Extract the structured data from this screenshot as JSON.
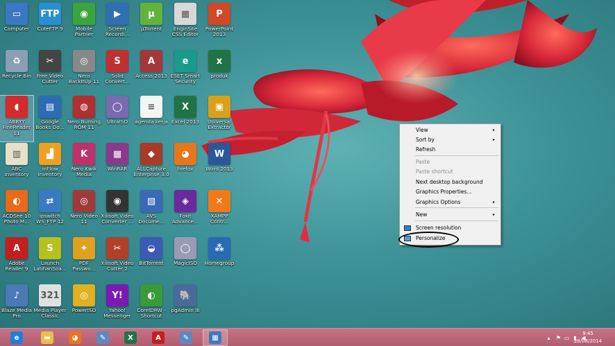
{
  "desktop": {
    "icons": [
      {
        "label": "Computer",
        "icon": "computer-icon",
        "color": "#3b78c4",
        "glyph": "▭"
      },
      {
        "label": "CuteFTP 9",
        "icon": "cuteftp-icon",
        "color": "#2a8fd0",
        "glyph": "FTP"
      },
      {
        "label": "Mobile\nPartner",
        "icon": "mobile-partner-icon",
        "color": "#3aa53a",
        "glyph": "◉"
      },
      {
        "label": "Screen\nRecordi...",
        "icon": "screen-recorder-icon",
        "color": "#2f6fb2",
        "glyph": "▶"
      },
      {
        "label": "µTorrent",
        "icon": "utorrent-icon",
        "color": "#62b33a",
        "glyph": "µ"
      },
      {
        "label": "EnginSite\nCSS Editor",
        "icon": "css-editor-icon",
        "color": "#d8d8d8",
        "glyph": "▦"
      },
      {
        "label": "PowerPoint\n2013",
        "icon": "powerpoint-icon",
        "color": "#d24726",
        "glyph": "P"
      },
      {
        "label": "Recycle Bin",
        "icon": "recycle-bin-icon",
        "color": "#8a9fb5",
        "glyph": "♻"
      },
      {
        "label": "Free Video\nCutter",
        "icon": "video-cutter-icon",
        "color": "#444444",
        "glyph": "✂"
      },
      {
        "label": "Nero\nBackItUp 11",
        "icon": "nero-backitup-icon",
        "color": "#888888",
        "glyph": "◎"
      },
      {
        "label": "Solid\nConvert...",
        "icon": "solid-converter-icon",
        "color": "#c03030",
        "glyph": "S"
      },
      {
        "label": "Access 2013",
        "icon": "access-icon",
        "color": "#a4373a",
        "glyph": "A"
      },
      {
        "label": "ESET Smart\nSecurity",
        "icon": "eset-icon",
        "color": "#1a9a8a",
        "glyph": "e"
      },
      {
        "label": "produk",
        "icon": "excel-file-icon",
        "color": "#217346",
        "glyph": "x"
      },
      {
        "label": "ABBYY\nFineReader\n11",
        "icon": "abbyy-icon",
        "color": "#d42a2a",
        "glyph": "◖"
      },
      {
        "label": "Google\nBooks Do...",
        "icon": "google-books-icon",
        "color": "#2d6bb5",
        "glyph": "▤"
      },
      {
        "label": "Nero Burning\nROM 11",
        "icon": "nero-burning-icon",
        "color": "#b03030",
        "glyph": "◍"
      },
      {
        "label": "UltraISO",
        "icon": "ultraiso-icon",
        "color": "#7a6ab0",
        "glyph": "◯"
      },
      {
        "label": "agenda kerja",
        "icon": "document-icon",
        "color": "#f4f4f4",
        "glyph": "≡"
      },
      {
        "label": "Excel 2013",
        "icon": "excel-icon",
        "color": "#217346",
        "glyph": "X"
      },
      {
        "label": "Universal\nExtractor",
        "icon": "universal-extractor-icon",
        "color": "#d9a11a",
        "glyph": "▣"
      },
      {
        "label": "ABC\nInventory",
        "icon": "abc-inventory-icon",
        "color": "#e8e0c8",
        "glyph": "▥"
      },
      {
        "label": "inFlow\nInventory",
        "icon": "inflow-icon",
        "color": "#f0a020",
        "glyph": "▟"
      },
      {
        "label": "Nero Kwik\nMedia",
        "icon": "nero-kwik-icon",
        "color": "#c0306a",
        "glyph": "K"
      },
      {
        "label": "WinRAR",
        "icon": "winrar-icon",
        "color": "#8a3a8a",
        "glyph": "▦"
      },
      {
        "label": "ALLCapture\nEnterprise 3.0",
        "icon": "allcapture-icon",
        "color": "#a83a2a",
        "glyph": "◆"
      },
      {
        "label": "firefox",
        "icon": "firefox-icon",
        "color": "#e8761a",
        "glyph": "◕"
      },
      {
        "label": "Word 2013",
        "icon": "word-icon",
        "color": "#2b579a",
        "glyph": "W"
      },
      {
        "label": "ACDSee 10\nPhoto M...",
        "icon": "acdsee-icon",
        "color": "#e86a1a",
        "glyph": "◐"
      },
      {
        "label": "ipswitch\nWS_FTP 12",
        "icon": "ws-ftp-icon",
        "color": "#3a7ac0",
        "glyph": "⇄"
      },
      {
        "label": "Nero Video\n11",
        "icon": "nero-video-icon",
        "color": "#a03a3a",
        "glyph": "◎"
      },
      {
        "label": "Xilisoft Video\nConverter ...",
        "icon": "xilisoft-converter-icon",
        "color": "#333333",
        "glyph": "◉"
      },
      {
        "label": "AVS\nDocume...",
        "icon": "avs-document-icon",
        "color": "#3a6ab5",
        "glyph": "▧"
      },
      {
        "label": "Foxit\nAdvance...",
        "icon": "foxit-icon",
        "color": "#6a2a9a",
        "glyph": "◈"
      },
      {
        "label": "XAMPP\nContr...",
        "icon": "xampp-icon",
        "color": "#f07a1a",
        "glyph": "✕"
      },
      {
        "label": "Adobe\nReader 9",
        "icon": "adobe-reader-icon",
        "color": "#c41e1e",
        "glyph": "A"
      },
      {
        "label": "Launch\nLatihanSoa...",
        "icon": "launch-icon",
        "color": "#b8c020",
        "glyph": "S"
      },
      {
        "label": "PDF\nPasswo...",
        "icon": "pdf-password-icon",
        "color": "#e0a020",
        "glyph": "✦"
      },
      {
        "label": "Xilisoft Video\nCutter 2",
        "icon": "xilisoft-cutter-icon",
        "color": "#b0402a",
        "glyph": "✂"
      },
      {
        "label": "BitTorrent",
        "icon": "bittorrent-icon",
        "color": "#3a5ab5",
        "glyph": "◒"
      },
      {
        "label": "MagicISO",
        "icon": "magiciso-icon",
        "color": "#9a9ab5",
        "glyph": "◯"
      },
      {
        "label": "Homegroup",
        "icon": "homegroup-icon",
        "color": "#2a6ab5",
        "glyph": "⁂"
      },
      {
        "label": "Blaze Media\nPro",
        "icon": "blaze-media-icon",
        "color": "#4a7ab5",
        "glyph": "♪"
      },
      {
        "label": "Media Player\nClassic",
        "icon": "media-player-classic-icon",
        "color": "#e0e0e0",
        "glyph": "321"
      },
      {
        "label": "PowerISO",
        "icon": "poweriso-icon",
        "color": "#e0b020",
        "glyph": "◎"
      },
      {
        "label": "Yahoo!\nMessenger",
        "icon": "yahoo-messenger-icon",
        "color": "#7a1ab0",
        "glyph": "Y!"
      },
      {
        "label": "CorelDRW -\nShortcut",
        "icon": "coreldraw-icon",
        "color": "#3a9a3a",
        "glyph": "◐"
      },
      {
        "label": "pgAdmin III",
        "icon": "pgadmin-icon",
        "color": "#4a6a9a",
        "glyph": "🐘"
      }
    ]
  },
  "context_menu": {
    "items": [
      {
        "label": "View",
        "disabled": false,
        "submenu": true,
        "name": "menu-item-view"
      },
      {
        "label": "Sort by",
        "disabled": false,
        "submenu": true,
        "name": "menu-item-sort-by"
      },
      {
        "label": "Refresh",
        "disabled": false,
        "submenu": false,
        "name": "menu-item-refresh"
      },
      {
        "label": "Paste",
        "disabled": true,
        "submenu": false,
        "name": "menu-item-paste"
      },
      {
        "label": "Paste shortcut",
        "disabled": true,
        "submenu": false,
        "name": "menu-item-paste-shortcut"
      },
      {
        "label": "Next desktop background",
        "disabled": false,
        "submenu": false,
        "name": "menu-item-next-background"
      },
      {
        "label": "Graphics Properties...",
        "disabled": false,
        "submenu": false,
        "name": "menu-item-graphics-properties"
      },
      {
        "label": "Graphics Options",
        "disabled": false,
        "submenu": true,
        "name": "menu-item-graphics-options"
      },
      {
        "label": "New",
        "disabled": false,
        "submenu": true,
        "name": "menu-item-new"
      },
      {
        "label": "Screen resolution",
        "disabled": false,
        "submenu": false,
        "name": "menu-item-screen-resolution"
      },
      {
        "label": "Personalize",
        "disabled": false,
        "submenu": false,
        "name": "menu-item-personalize"
      }
    ],
    "submenu_arrow": "▸"
  },
  "taskbar": {
    "buttons": [
      {
        "icon": "internet-explorer-icon",
        "glyph": "e",
        "color": "#1e7fd8"
      },
      {
        "icon": "file-explorer-icon",
        "glyph": "▬",
        "color": "#e8c04a"
      },
      {
        "icon": "firefox-icon",
        "glyph": "◕",
        "color": "#e8761a"
      },
      {
        "icon": "paint-icon",
        "glyph": "✎",
        "color": "#5a8ac0"
      },
      {
        "icon": "excel-icon",
        "glyph": "X",
        "color": "#217346"
      },
      {
        "icon": "adobe-reader-icon",
        "glyph": "A",
        "color": "#c41e1e"
      },
      {
        "icon": "paint-icon",
        "glyph": "✎",
        "color": "#5a8ac0"
      },
      {
        "icon": "control-panel-icon",
        "glyph": "▦",
        "color": "#3a7ac0"
      }
    ],
    "tray": {
      "time": "9:45",
      "date": "28/08/2014",
      "icons": [
        "chevron-up-icon",
        "flag-icon",
        "display-icon",
        "network-icon",
        "volume-icon"
      ]
    }
  },
  "colors": {
    "taskbar": "#b86275",
    "desktop_bg": "#3d9297",
    "flower": "#d8283a"
  }
}
